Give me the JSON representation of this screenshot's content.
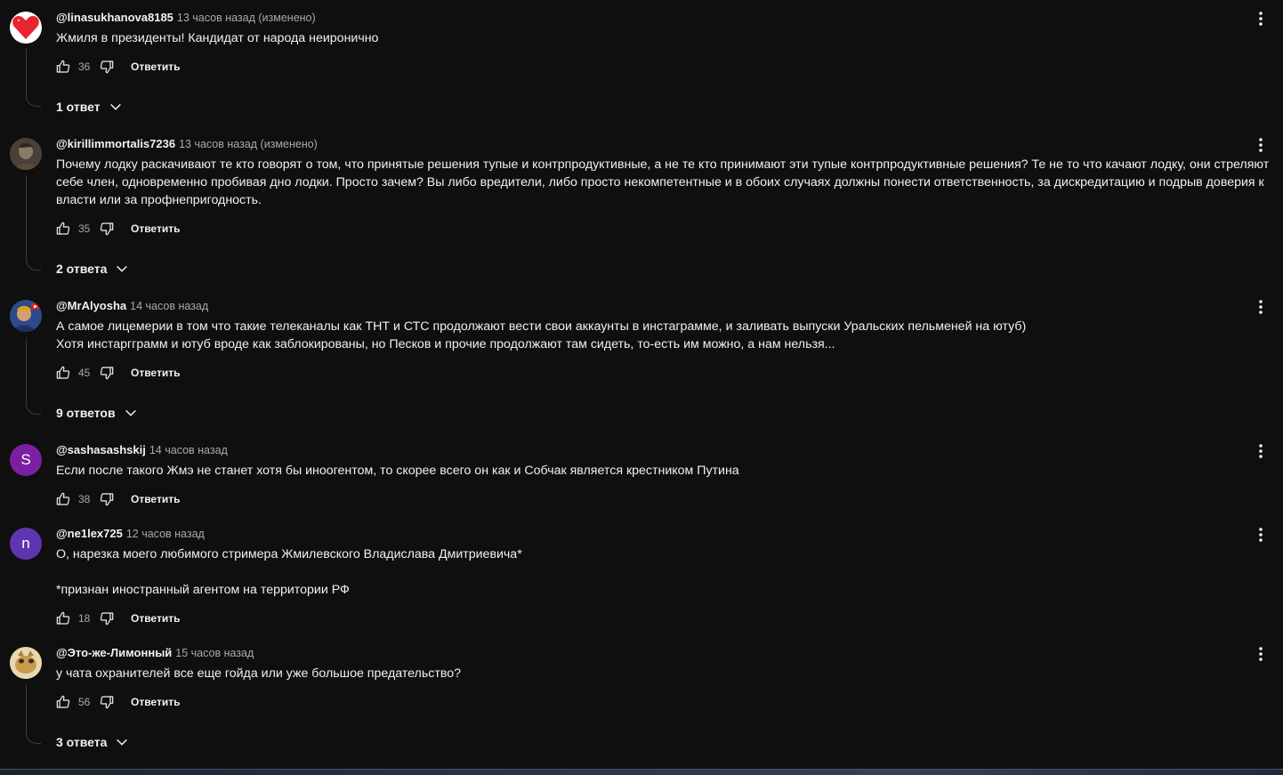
{
  "comments": [
    {
      "author": "@linasukhanova8185",
      "time": "13 часов назад (изменено)",
      "text": "Жмиля в президенты! Кандидат от народа неиронично",
      "likes": "36",
      "reply_label": "Ответить",
      "replies_label": "1 ответ",
      "avatar": {
        "type": "heart-icon",
        "color": "#e8242e",
        "bg": "#ffffff"
      }
    },
    {
      "author": "@kirillimmortalis7236",
      "time": "13 часов назад (изменено)",
      "text": "Почему лодку раскачивают те кто говорят о том, что принятые решения тупые и контрпродуктивные, а не те кто принимают эти тупые контрпродуктивные решения? Те не то что качают лодку, они стреляют себе член, одновременно пробивая дно лодки. Просто зачем? Вы либо вредители, либо просто некомпетентные и в обоих случаях должны понести ответственность, за дискредитацию и подрыв доверия к власти или за профнепригодность.",
      "likes": "35",
      "reply_label": "Ответить",
      "replies_label": "2 ответа",
      "avatar": {
        "type": "photo",
        "color": "#6b5a4a",
        "bg": "#3d3530"
      }
    },
    {
      "author": "@MrAlyosha",
      "time": "14 часов назад",
      "text": "А самое лицемерии в том что такие телеканалы как ТНТ и СТС продолжают вести свои аккаунты в инстаграмме, и заливать выпуски Уральских пельменей на ютуб)\nХотя инстаргграмм и ютуб вроде как заблокированы, но Песков и прочие продолжают там сидеть, то-есть им можно, а нам нельзя...",
      "likes": "45",
      "reply_label": "Ответить",
      "replies_label": "9 ответов",
      "avatar": {
        "type": "photo",
        "color": "#3b62b0",
        "bg": "#2a3e6e"
      }
    },
    {
      "author": "@sashasashskij",
      "time": "14 часов назад",
      "text": "Если после такого Жмэ не станет хотя бы иноогентом, то скорее всего он как и Собчак является крестником Путина",
      "likes": "38",
      "reply_label": "Ответить",
      "replies_label": "",
      "avatar": {
        "type": "letter",
        "letter": "S",
        "bg": "#7b1fa2"
      }
    },
    {
      "author": "@ne1lex725",
      "time": "12 часов назад",
      "text": "О, нарезка моего любимого стримера Жмилевского Владислава Дмитриевича*\n\n*признан иностранный агентом на территории РФ",
      "likes": "18",
      "reply_label": "Ответить",
      "replies_label": "",
      "avatar": {
        "type": "letter",
        "letter": "n",
        "bg": "#5e35b1"
      }
    },
    {
      "author": "@Это-же-Лимонный",
      "time": "15 часов назад",
      "text": "у чата охранителей все еще гойда или уже большое предательство?",
      "likes": "56",
      "reply_label": "Ответить",
      "replies_label": "3 ответа",
      "avatar": {
        "type": "photo",
        "color": "#c8a060",
        "bg": "#8a6a3a"
      }
    }
  ]
}
